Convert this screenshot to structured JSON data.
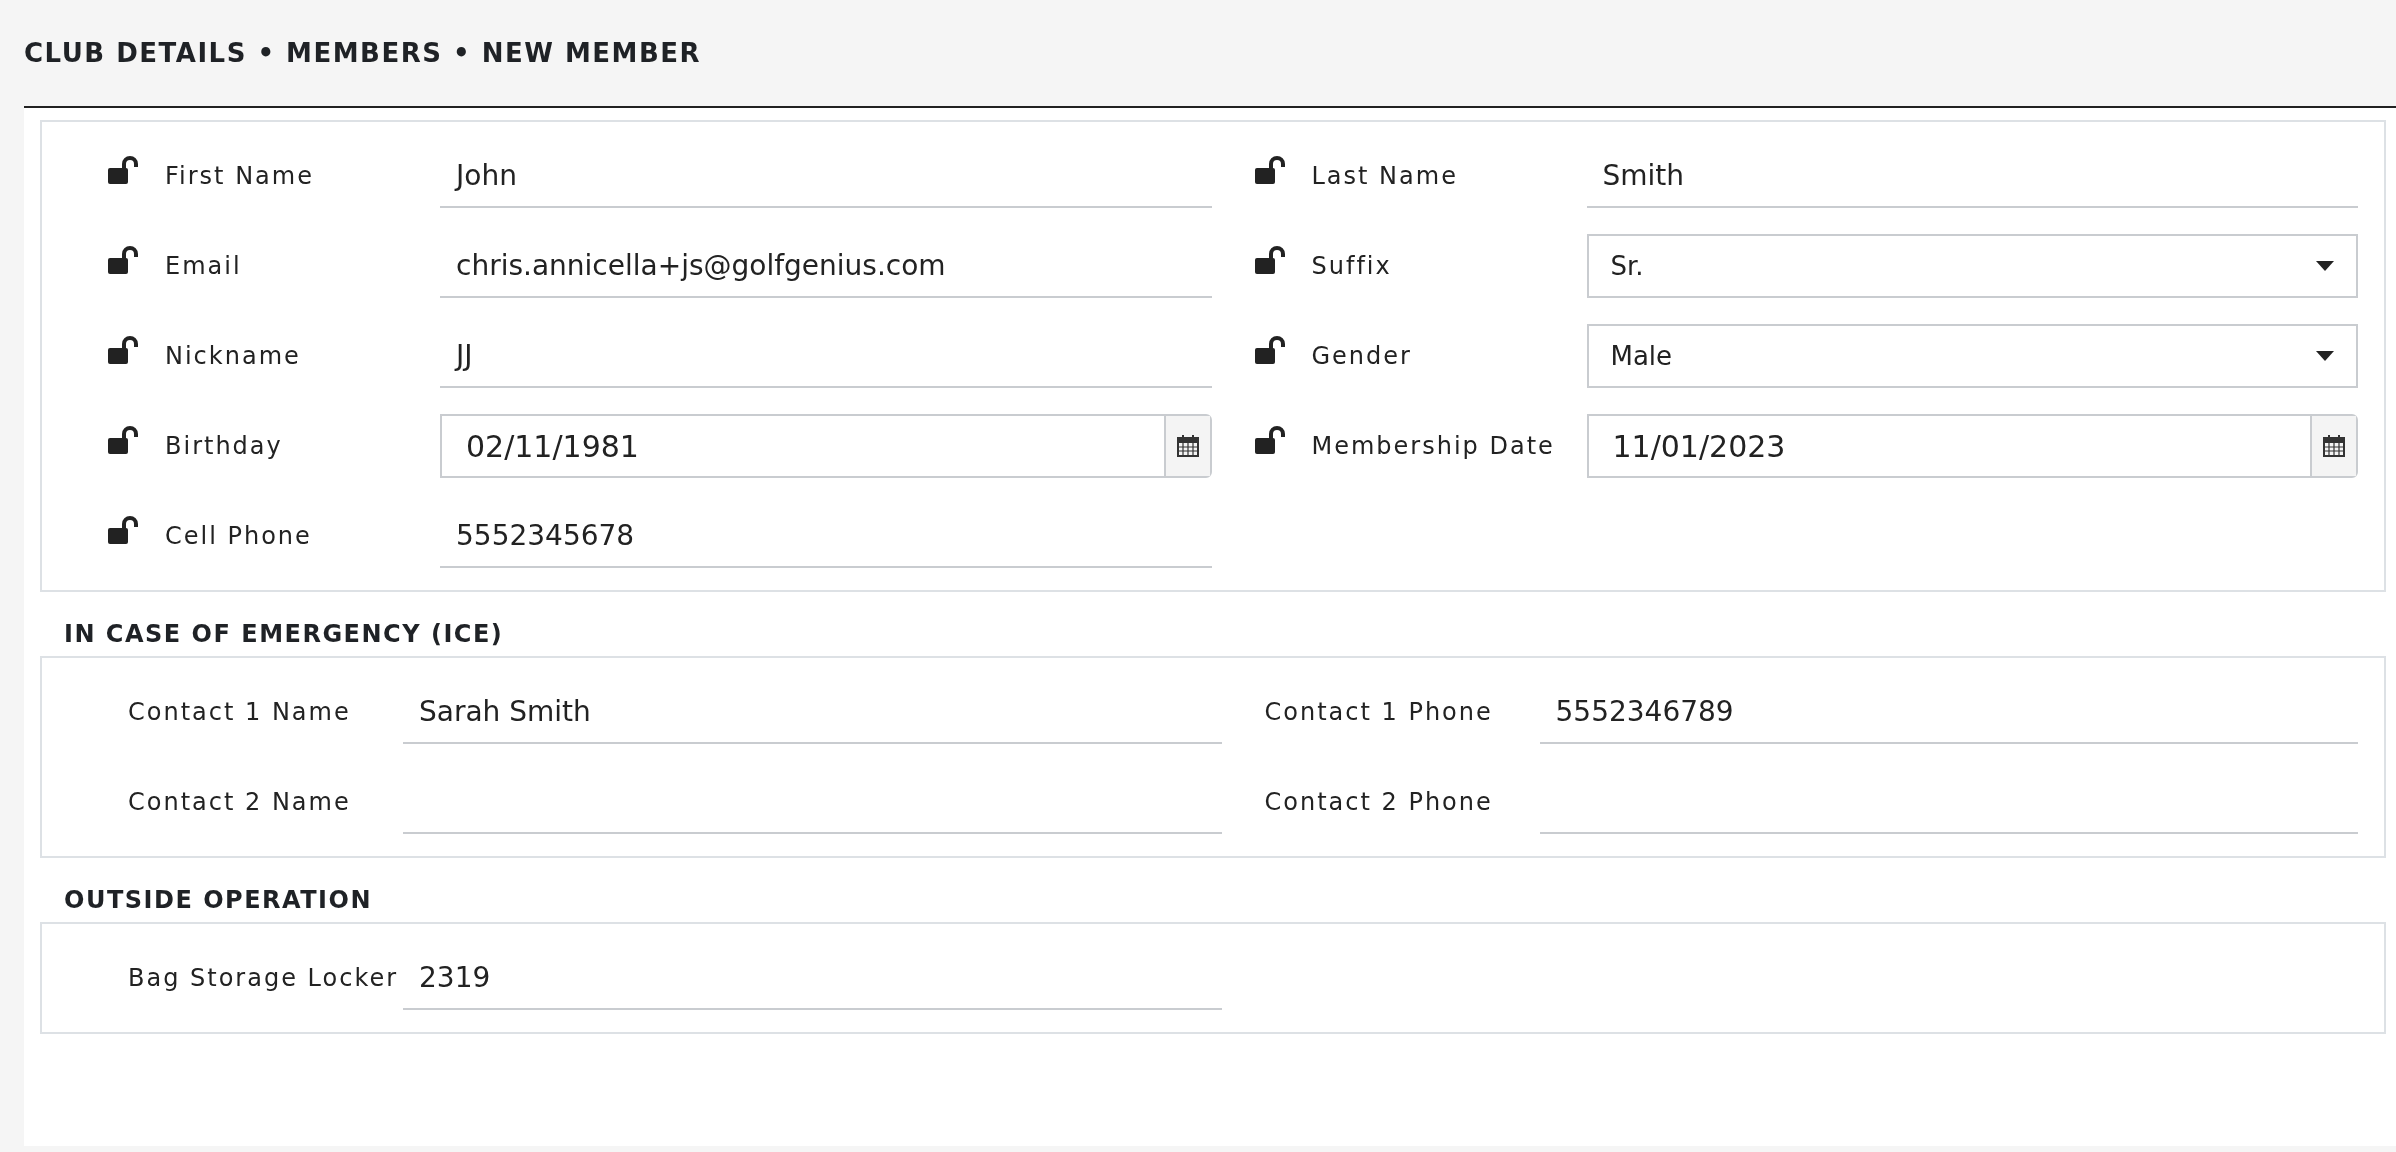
{
  "breadcrumb": "CLUB DETAILS • MEMBERS • NEW MEMBER",
  "sections": [
    {
      "columns": [
        [
          {
            "kind": "text",
            "label": "First Name",
            "value": "John",
            "locked": false
          },
          {
            "kind": "text",
            "label": "Email",
            "value": "chris.annicella+js@golfgenius.com",
            "locked": false
          },
          {
            "kind": "text",
            "label": "Nickname",
            "value": "JJ",
            "locked": false
          },
          {
            "kind": "date",
            "label": "Birthday",
            "value": "02/11/1981",
            "locked": false
          },
          {
            "kind": "text",
            "label": "Cell Phone",
            "value": "5552345678",
            "locked": false
          }
        ],
        [
          {
            "kind": "text",
            "label": "Last Name",
            "value": "Smith",
            "locked": false
          },
          {
            "kind": "select",
            "label": "Suffix",
            "value": "Sr.",
            "locked": false
          },
          {
            "kind": "select",
            "label": "Gender",
            "value": "Male",
            "locked": false
          },
          {
            "kind": "date",
            "label": "Membership Date",
            "value": "11/01/2023",
            "locked": false
          }
        ]
      ]
    },
    {
      "title": "IN CASE OF EMERGENCY (ICE)",
      "columns": [
        [
          {
            "kind": "text",
            "label": "Contact 1 Name",
            "value": "Sarah Smith"
          },
          {
            "kind": "text",
            "label": "Contact 2 Name"
          }
        ],
        [
          {
            "kind": "text",
            "label": "Contact 1 Phone",
            "value": "5552346789"
          },
          {
            "kind": "text",
            "label": "Contact 2 Phone"
          }
        ]
      ]
    },
    {
      "title": "OUTSIDE OPERATION",
      "columns": [
        [
          {
            "kind": "text",
            "label": "Bag Storage Locker",
            "value": "2319"
          }
        ]
      ]
    }
  ]
}
